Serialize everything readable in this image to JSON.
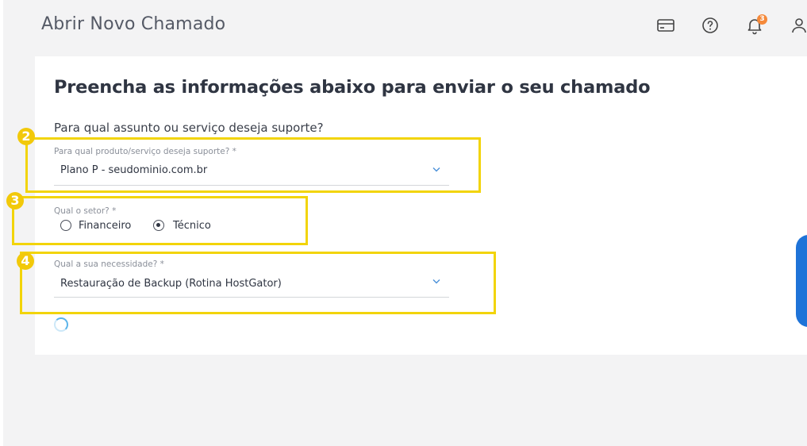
{
  "header": {
    "title": "Abrir Novo Chamado",
    "notification_count": "3",
    "icons": [
      "card-icon",
      "help-icon",
      "bell-icon",
      "user-icon"
    ]
  },
  "form": {
    "title": "Preencha as informações abaixo para enviar o seu chamado",
    "question": "Para qual assunto ou serviço deseja suporte?",
    "product": {
      "step": "2",
      "label": "Para qual produto/serviço deseja suporte? *",
      "value": "Plano P - seudominio.com.br"
    },
    "sector": {
      "step": "3",
      "label": "Qual o setor? *",
      "options": [
        "Financeiro",
        "Técnico"
      ],
      "selected": "Técnico"
    },
    "need": {
      "step": "4",
      "label": "Qual a sua necessidade? *",
      "value": "Restauração de Backup (Rotina HostGator)"
    }
  },
  "colors": {
    "highlight": "#f2d40a",
    "badge": "#f5893a",
    "accent_blue": "#1e73d8",
    "spinner": "#5bb4ea"
  }
}
